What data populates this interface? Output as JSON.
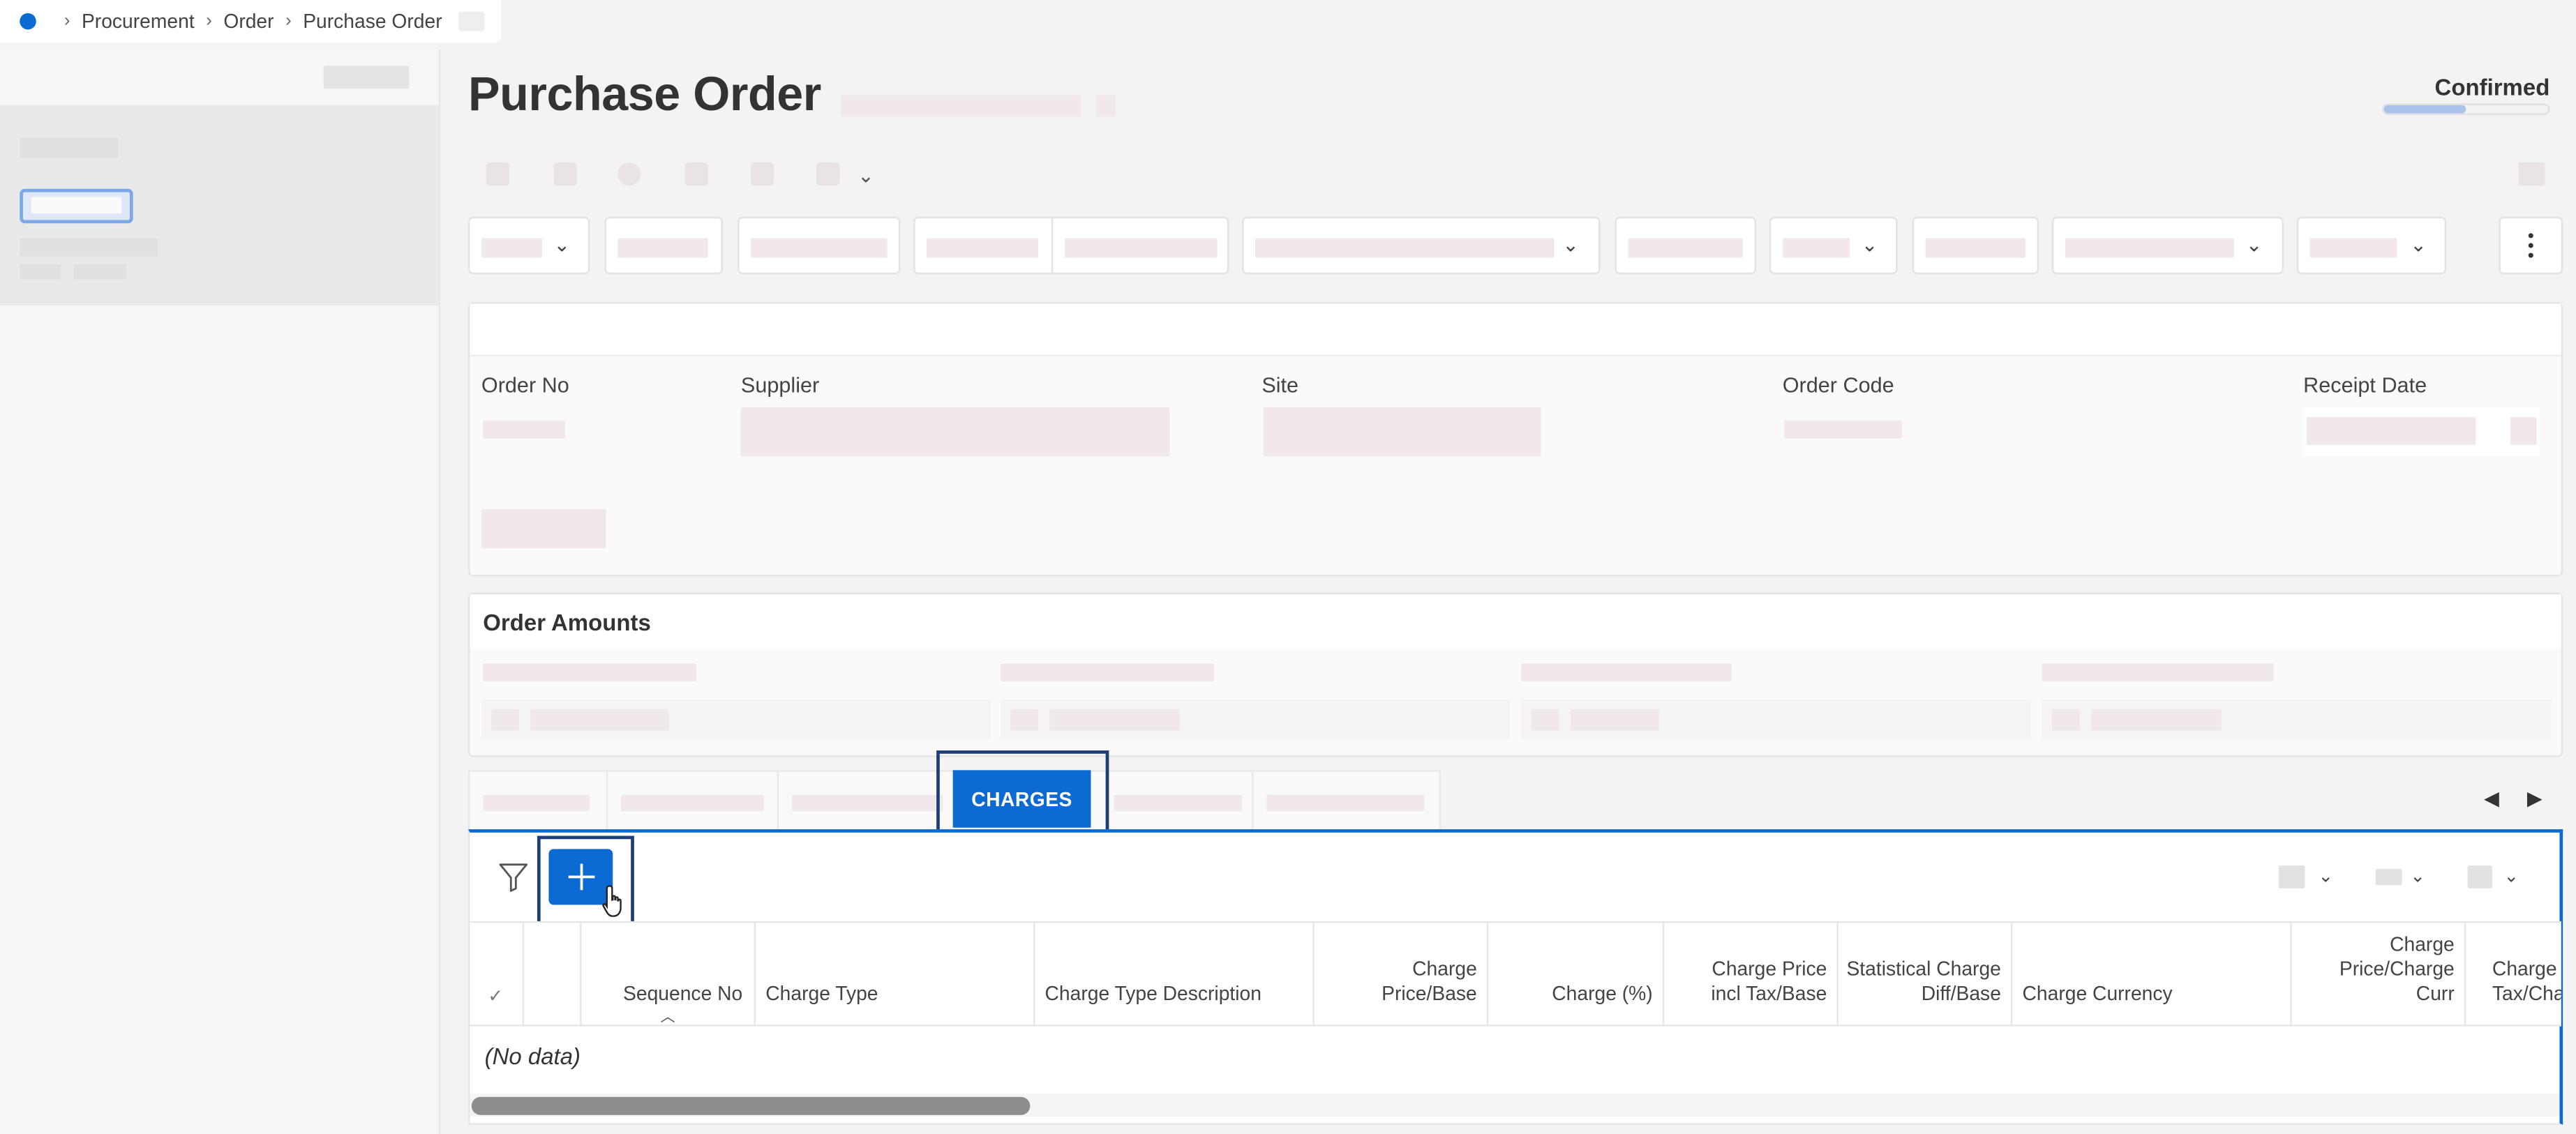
{
  "breadcrumb": {
    "items": [
      "Procurement",
      "Order",
      "Purchase Order"
    ]
  },
  "page": {
    "title": "Purchase Order",
    "status": "Confirmed",
    "status_progress": 0.5
  },
  "header_fields": {
    "order_no_label": "Order No",
    "supplier_label": "Supplier",
    "site_label": "Site",
    "order_code_label": "Order Code",
    "receipt_date_label": "Receipt Date"
  },
  "order_amounts": {
    "title": "Order Amounts"
  },
  "tabs": {
    "active_label": "CHARGES"
  },
  "table": {
    "columns": [
      "Sequence No",
      "Charge Type",
      "Charge Type Description",
      "Charge Price/Base",
      "Charge (%)",
      "Charge Price incl Tax/Base",
      "Statistical Charge Diff/Base",
      "Charge Currency",
      "Charge Price/Charge Curr",
      "Charge P Tax/Cha"
    ],
    "empty_text": "(No data)"
  },
  "icons": {
    "home": "home-dot-icon",
    "filter": "filter-icon",
    "add": "plus-icon",
    "cursor": "hand-pointer-icon",
    "kebab": "more-vertical-icon"
  },
  "colors": {
    "accent": "#0b6bd3",
    "focus_frame": "#1e3e78"
  }
}
